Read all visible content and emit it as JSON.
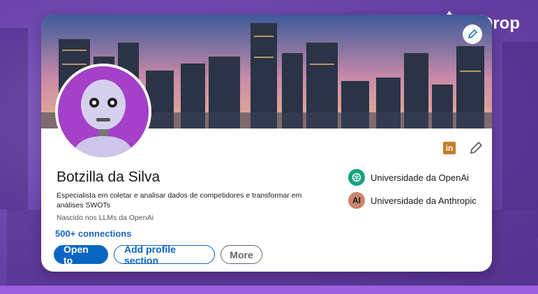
{
  "brand": {
    "name": "AiDrop",
    "icon": "drop-icon"
  },
  "profile": {
    "name": "Botzilla da Silva",
    "headline": "Especialista em coletar e analisar dados de competidores e transformar em análises SWOTs",
    "location": "Nascido nos LLMs da OpenAi",
    "connections": "500+ connections"
  },
  "buttons": {
    "open_to": "Open to",
    "add_section": "Add profile section",
    "more": "More"
  },
  "icons": {
    "linkedin": "in"
  },
  "education": [
    {
      "name": "Universidade da OpenAi",
      "logo_color": "#10a37f",
      "icon": "openai-logo-icon"
    },
    {
      "name": "Universidade da Anthropic",
      "logo_color": "#c9866a",
      "logo_text": "AI",
      "icon": "anthropic-logo-icon"
    }
  ],
  "colors": {
    "accent": "#0a66c2",
    "brand_bg": "#6f48b0"
  }
}
